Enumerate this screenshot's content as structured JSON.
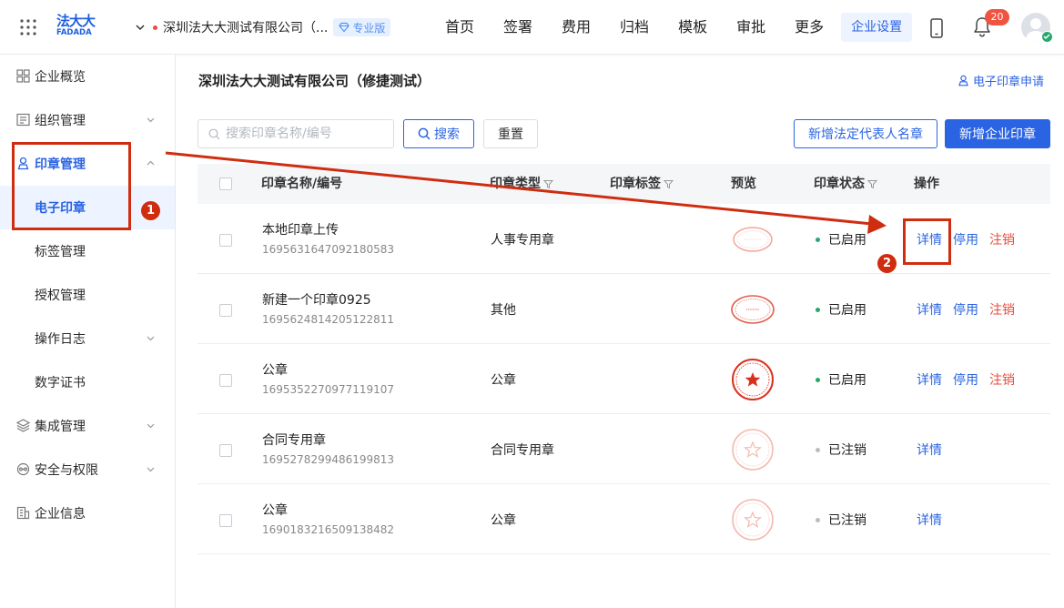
{
  "topbar": {
    "logo_cn": "法大大",
    "logo_en": "FADADA",
    "company_name": "深圳法大大测试有限公司（...",
    "edition_badge": "专业版",
    "nav": [
      "首页",
      "签署",
      "费用",
      "归档",
      "模板",
      "审批",
      "更多",
      "企业设置"
    ],
    "active_nav": "企业设置",
    "notification_count": "20"
  },
  "sidebar": {
    "items": [
      {
        "label": "企业概览",
        "icon": "overview-icon"
      },
      {
        "label": "组织管理",
        "icon": "org-icon"
      },
      {
        "label": "印章管理",
        "icon": "seal-icon"
      },
      {
        "label": "电子印章"
      },
      {
        "label": "标签管理"
      },
      {
        "label": "授权管理"
      },
      {
        "label": "操作日志"
      },
      {
        "label": "数字证书"
      },
      {
        "label": "集成管理",
        "icon": "integration-icon"
      },
      {
        "label": "安全与权限",
        "icon": "security-icon"
      },
      {
        "label": "企业信息",
        "icon": "building-icon"
      }
    ]
  },
  "main": {
    "title": "深圳法大大测试有限公司（修捷测试）",
    "apply_link": "电子印章申请",
    "search_placeholder": "搜索印章名称/编号",
    "search_button": "搜索",
    "reset_button": "重置",
    "legal_rep_button": "新增法定代表人名章",
    "new_seal_button": "新增企业印章"
  },
  "table": {
    "headers": {
      "name": "印章名称/编号",
      "type": "印章类型",
      "tag": "印章标签",
      "preview": "预览",
      "status": "印章状态",
      "actions": "操作"
    },
    "rows": [
      {
        "name": "本地印章上传",
        "code": "1695631647092180583",
        "type": "人事专用章",
        "status": "已启用",
        "actions": [
          "详情",
          "停用",
          "注销"
        ]
      },
      {
        "name": "新建一个印章0925",
        "code": "1695624814205122811",
        "type": "其他",
        "status": "已启用",
        "actions": [
          "详情",
          "停用",
          "注销"
        ]
      },
      {
        "name": "公章",
        "code": "1695352270977119107",
        "type": "公章",
        "status": "已启用",
        "actions": [
          "详情",
          "停用",
          "注销"
        ]
      },
      {
        "name": "合同专用章",
        "code": "1695278299486199813",
        "type": "合同专用章",
        "status": "已注销",
        "actions": [
          "详情"
        ]
      },
      {
        "name": "公章",
        "code": "1690183216509138482",
        "type": "公章",
        "status": "已注销",
        "actions": [
          "详情"
        ]
      }
    ]
  },
  "annotations": [
    "1",
    "2"
  ],
  "colors": {
    "primary": "#2b64e3",
    "danger": "#ea4b3c",
    "enabled": "#27a86c",
    "disabled": "#b8bcc4",
    "annotation": "#cf2d10"
  }
}
